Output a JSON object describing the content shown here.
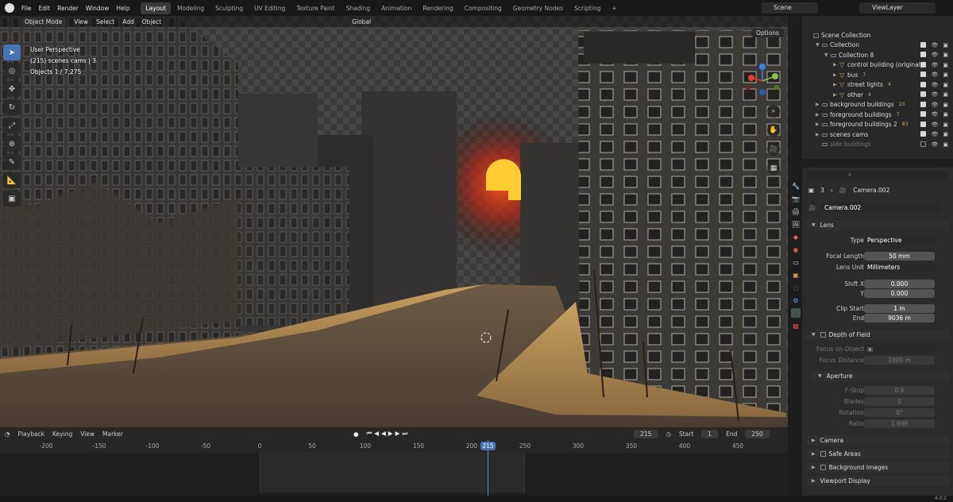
{
  "menu": [
    "File",
    "Edit",
    "Render",
    "Window",
    "Help"
  ],
  "workspaces": [
    "Layout",
    "Modeling",
    "Sculpting",
    "UV Editing",
    "Texture Paint",
    "Shading",
    "Animation",
    "Rendering",
    "Compositing",
    "Geometry Nodes",
    "Scripting"
  ],
  "active_workspace": "Layout",
  "scene": "Scene",
  "view_layer": "ViewLayer",
  "viewport": {
    "mode": "Object Mode",
    "menus": [
      "View",
      "Select",
      "Add",
      "Object"
    ],
    "orientation": "Global",
    "options": "Options",
    "overlay_lines": [
      "User Perspective",
      "(215) scenes cams | 3",
      "Objects      1 / 7,275"
    ]
  },
  "outliner": {
    "rows": [
      {
        "label": "Scene Collection",
        "depth": 0,
        "arrow": "",
        "icon": "scene-collection-icon",
        "visible": false
      },
      {
        "label": "Collection",
        "depth": 1,
        "arrow": "▼",
        "icon": "collection-icon",
        "visible": true
      },
      {
        "label": "Collection 8",
        "depth": 2,
        "arrow": "▼",
        "icon": "collection-icon",
        "visible": true
      },
      {
        "label": "control building (original)",
        "depth": 3,
        "arrow": "▶",
        "icon": "object-icon",
        "visible": true
      },
      {
        "label": "bus",
        "depth": 3,
        "arrow": "▶",
        "icon": "object-icon",
        "badge": "7",
        "visible": true
      },
      {
        "label": "street lights",
        "depth": 3,
        "arrow": "▶",
        "icon": "object-icon",
        "badge": "4",
        "visible": true
      },
      {
        "label": "other",
        "depth": 3,
        "arrow": "▶",
        "icon": "object-icon",
        "badge": "4",
        "visible": true
      },
      {
        "label": "background buildings",
        "depth": 1,
        "arrow": "▶",
        "icon": "collection-icon",
        "badge": "23",
        "visible": true
      },
      {
        "label": "foreground buildings",
        "depth": 1,
        "arrow": "▶",
        "icon": "collection-icon",
        "badge": "7",
        "visible": true
      },
      {
        "label": "foreground buildings 2",
        "depth": 1,
        "arrow": "▶",
        "icon": "collection-icon",
        "badge": "83",
        "visible": true
      },
      {
        "label": "scenes cams",
        "depth": 1,
        "arrow": "▶",
        "icon": "collection-icon",
        "visible": true
      },
      {
        "label": "side buildings",
        "depth": 1,
        "arrow": "",
        "icon": "collection-icon",
        "visible": false
      }
    ]
  },
  "properties": {
    "breadcrumb_num": "3",
    "breadcrumb": "Camera.002",
    "datablock": "Camera.002",
    "lens_section": "Lens",
    "type_label": "Type",
    "type_value": "Perspective",
    "focal_label": "Focal Length",
    "focal_value": "50 mm",
    "lens_unit_label": "Lens Unit",
    "lens_unit_value": "Millimeters",
    "shift_x_label": "Shift X",
    "shift_x_value": "0.000",
    "shift_y_label": "Y",
    "shift_y_value": "0.000",
    "clip_start_label": "Clip Start",
    "clip_start_value": "1 m",
    "clip_end_label": "End",
    "clip_end_value": "9036 m",
    "dof_section": "Depth of Field",
    "focus_obj_label": "Focus on Object",
    "focus_dist_label": "Focus Distance",
    "focus_dist_value": "1000 m",
    "aperture_section": "Aperture",
    "fstop_label": "F-Stop",
    "fstop_value": "0.6",
    "blades_label": "Blades",
    "blades_value": "0",
    "rotation_label": "Rotation",
    "rotation_value": "0°",
    "ratio_label": "Ratio",
    "ratio_value": "1.998",
    "panels": [
      "Camera",
      "Safe Areas",
      "Background Images",
      "Viewport Display"
    ]
  },
  "timeline": {
    "menus": [
      "Playback",
      "Keying",
      "View",
      "Marker"
    ],
    "current_frame": "215",
    "start_label": "Start",
    "start": "1",
    "end_label": "End",
    "end": "250",
    "ticks": [
      "-200",
      "-150",
      "-100",
      "-50",
      "0",
      "50",
      "100",
      "150",
      "200",
      "250",
      "300",
      "350",
      "400",
      "450"
    ]
  },
  "version": "4.0.2",
  "colors": {
    "accent": "#4772b3",
    "sun": "#ffcc33",
    "active_tool": "#4772b3"
  }
}
